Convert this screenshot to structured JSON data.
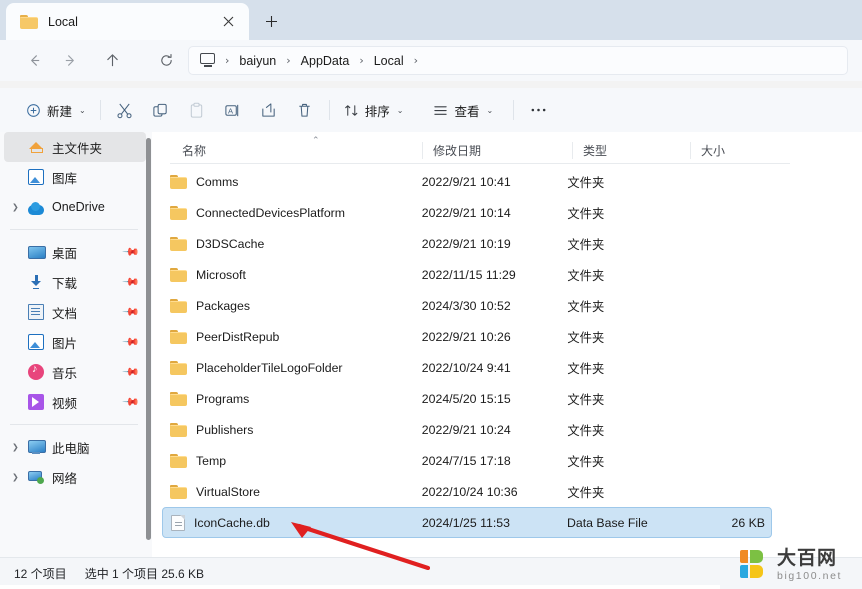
{
  "window": {
    "tab": {
      "title": "Local",
      "folder_icon": "folder-icon",
      "close_icon": "close-icon"
    },
    "new_tab_icon": "plus-icon"
  },
  "nav": {
    "back_icon": "arrow-left-icon",
    "forward_icon": "arrow-right-icon",
    "up_icon": "arrow-up-icon",
    "refresh_icon": "refresh-icon",
    "address": {
      "root_icon": "this-pc-icon",
      "separator": "›",
      "crumbs": [
        "baiyun",
        "AppData",
        "Local"
      ]
    }
  },
  "toolbar": {
    "new_label": "新建",
    "new_icon": "plus-circle-icon",
    "cut_icon": "scissors-icon",
    "copy_icon": "copy-icon",
    "paste_icon": "paste-icon",
    "rename_icon": "rename-icon",
    "share_icon": "share-icon",
    "delete_icon": "trash-icon",
    "sort_label": "排序",
    "sort_icon": "sort-icon",
    "view_label": "查看",
    "view_icon": "view-list-icon",
    "more_icon": "ellipsis-icon",
    "chevron": "⌄"
  },
  "sidebar": {
    "items": [
      {
        "label": "主文件夹",
        "icon": "home-icon",
        "selected": true,
        "expandable": false,
        "pinned": false
      },
      {
        "label": "图库",
        "icon": "gallery-icon",
        "selected": false,
        "expandable": false,
        "pinned": false
      },
      {
        "label": "OneDrive",
        "icon": "cloud-icon",
        "selected": false,
        "expandable": true,
        "pinned": false
      },
      {
        "label": "桌面",
        "icon": "desktop-icon",
        "selected": false,
        "expandable": false,
        "pinned": true
      },
      {
        "label": "下载",
        "icon": "download-icon",
        "selected": false,
        "expandable": false,
        "pinned": true
      },
      {
        "label": "文档",
        "icon": "document-icon",
        "selected": false,
        "expandable": false,
        "pinned": true
      },
      {
        "label": "图片",
        "icon": "pictures-icon",
        "selected": false,
        "expandable": false,
        "pinned": true
      },
      {
        "label": "音乐",
        "icon": "music-icon",
        "selected": false,
        "expandable": false,
        "pinned": true
      },
      {
        "label": "视频",
        "icon": "video-icon",
        "selected": false,
        "expandable": false,
        "pinned": true
      },
      {
        "label": "此电脑",
        "icon": "this-pc-icon",
        "selected": false,
        "expandable": true,
        "pinned": false
      },
      {
        "label": "网络",
        "icon": "network-icon",
        "selected": false,
        "expandable": true,
        "pinned": false
      }
    ]
  },
  "filelist": {
    "columns": [
      "名称",
      "修改日期",
      "类型",
      "大小"
    ],
    "sort_caret": "⌃",
    "rows": [
      {
        "name": "Comms",
        "date": "2022/9/21 10:41",
        "type": "文件夹",
        "size": "",
        "icon": "folder-icon",
        "selected": false
      },
      {
        "name": "ConnectedDevicesPlatform",
        "date": "2022/9/21 10:14",
        "type": "文件夹",
        "size": "",
        "icon": "folder-icon",
        "selected": false
      },
      {
        "name": "D3DSCache",
        "date": "2022/9/21 10:19",
        "type": "文件夹",
        "size": "",
        "icon": "folder-icon",
        "selected": false
      },
      {
        "name": "Microsoft",
        "date": "2022/11/15 11:29",
        "type": "文件夹",
        "size": "",
        "icon": "folder-icon",
        "selected": false
      },
      {
        "name": "Packages",
        "date": "2024/3/30 10:52",
        "type": "文件夹",
        "size": "",
        "icon": "folder-icon",
        "selected": false
      },
      {
        "name": "PeerDistRepub",
        "date": "2022/9/21 10:26",
        "type": "文件夹",
        "size": "",
        "icon": "folder-icon",
        "selected": false
      },
      {
        "name": "PlaceholderTileLogoFolder",
        "date": "2022/10/24 9:41",
        "type": "文件夹",
        "size": "",
        "icon": "folder-icon",
        "selected": false
      },
      {
        "name": "Programs",
        "date": "2024/5/20 15:15",
        "type": "文件夹",
        "size": "",
        "icon": "folder-icon",
        "selected": false
      },
      {
        "name": "Publishers",
        "date": "2022/9/21 10:24",
        "type": "文件夹",
        "size": "",
        "icon": "folder-icon",
        "selected": false
      },
      {
        "name": "Temp",
        "date": "2024/7/15 17:18",
        "type": "文件夹",
        "size": "",
        "icon": "folder-icon",
        "selected": false
      },
      {
        "name": "VirtualStore",
        "date": "2022/10/24 10:36",
        "type": "文件夹",
        "size": "",
        "icon": "folder-icon",
        "selected": false
      },
      {
        "name": "IconCache.db",
        "date": "2024/1/25 11:53",
        "type": "Data Base File",
        "size": "26 KB",
        "icon": "database-file-icon",
        "selected": true
      }
    ]
  },
  "statusbar": {
    "item_count": "12 个项目",
    "selection": "选中 1 个项目  25.6 KB"
  },
  "annotation": {
    "arrow_icon": "red-arrow-icon",
    "arrow_color": "#e02020"
  },
  "watermark": {
    "cn": "大百网",
    "en": "big100.net",
    "colors": {
      "orange": "#f08a24",
      "green": "#7cc043",
      "blue": "#29a8e0",
      "yellow": "#f5c518"
    }
  }
}
